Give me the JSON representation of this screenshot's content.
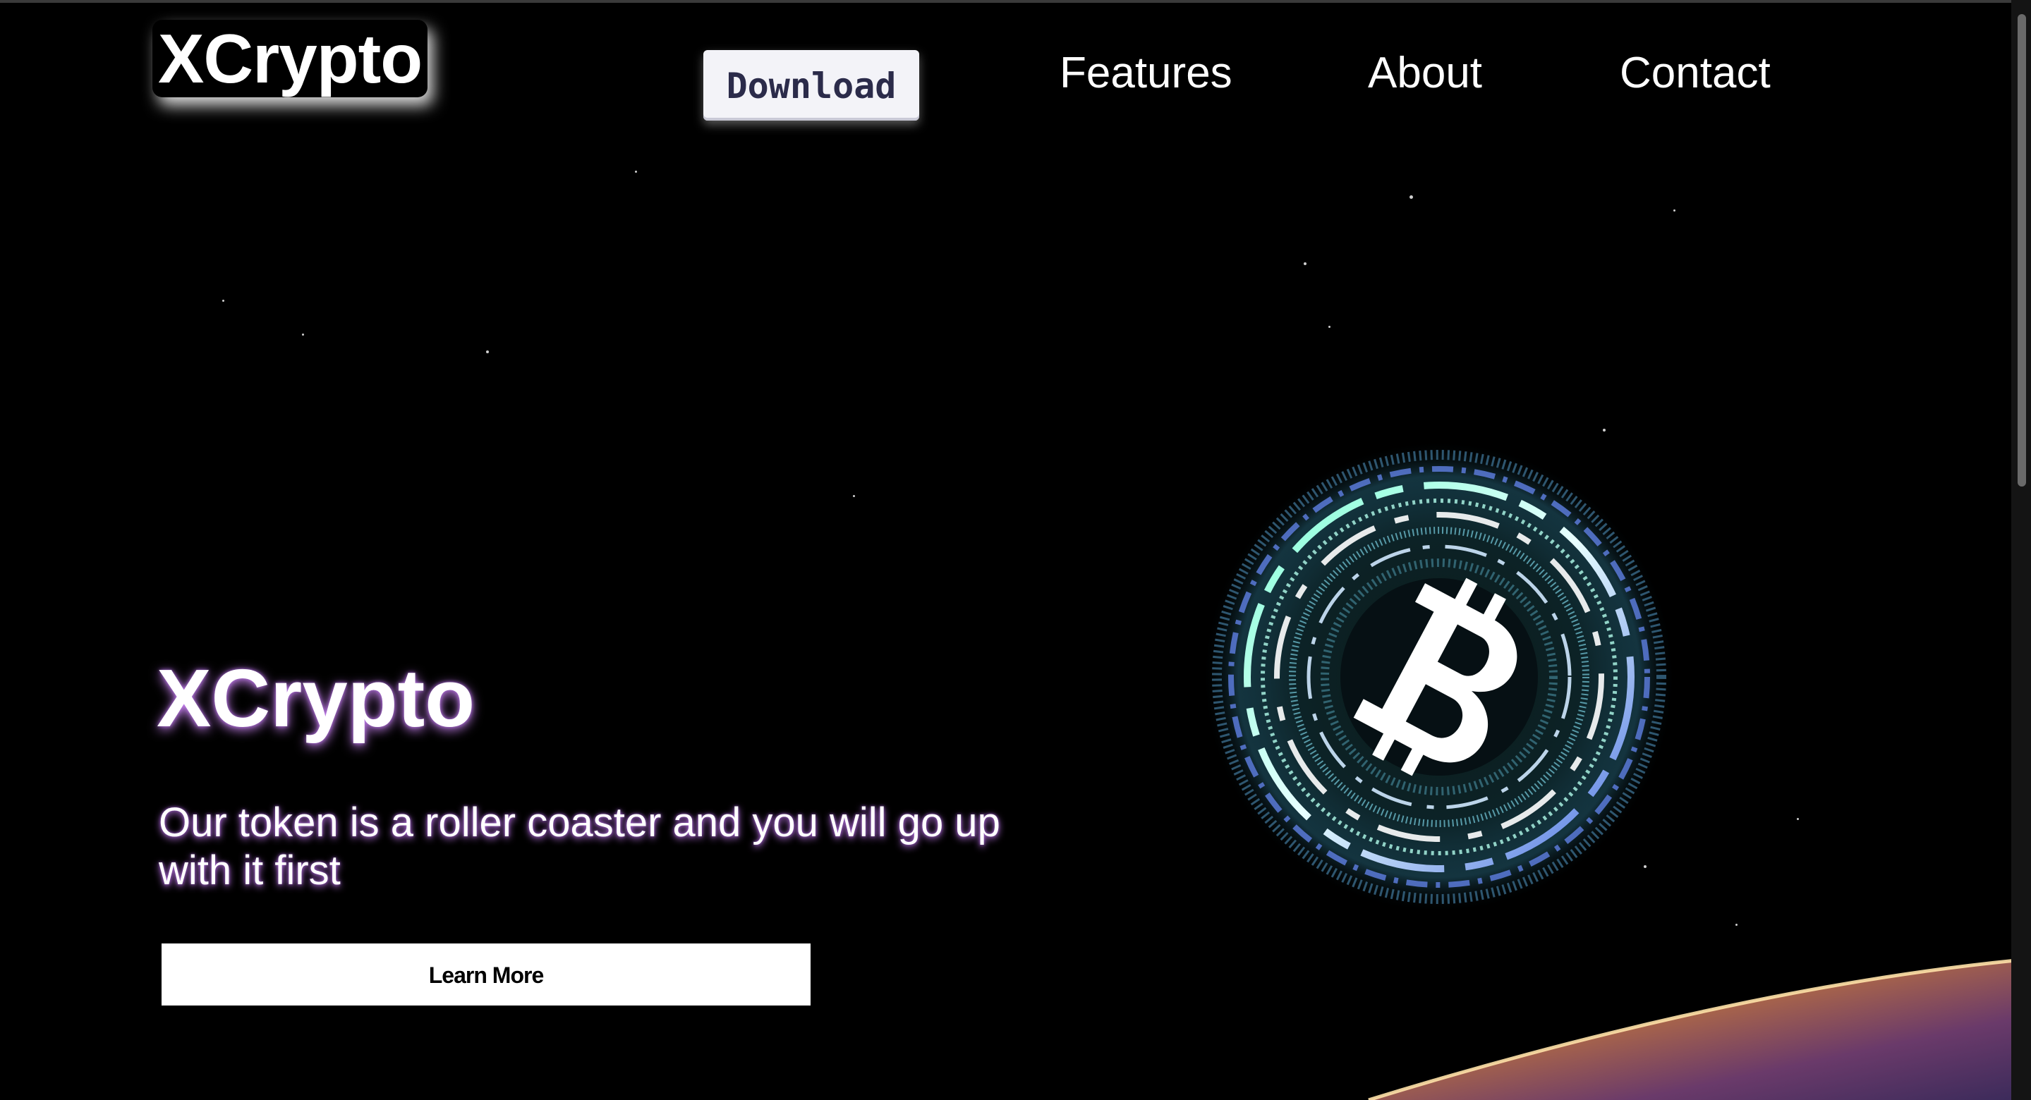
{
  "nav": {
    "logo": "XCrypto",
    "download": "Download",
    "links": [
      "Features",
      "About",
      "Contact"
    ]
  },
  "hero": {
    "title": "XCrypto",
    "subtitle": "Our token is a roller coaster and you will go up with it first",
    "cta": "Learn More"
  },
  "icons": {
    "coin": "bitcoin-icon"
  },
  "colors": {
    "background": "#000000",
    "text": "#ffffff",
    "glow": "#d68cff",
    "download_text": "#2b2b4a",
    "download_bg": "#f3f3f8",
    "cta_bg": "#ffffff"
  }
}
